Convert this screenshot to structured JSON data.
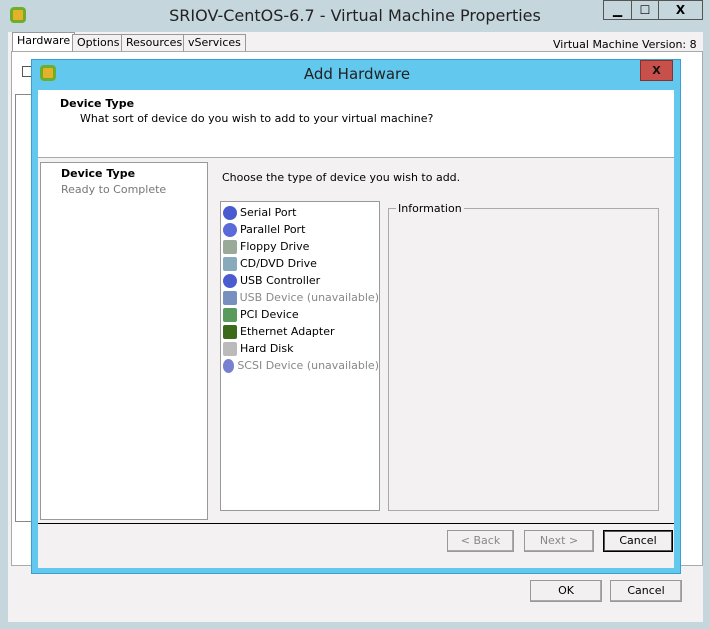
{
  "window": {
    "title": "SRIOV-CentOS-6.7 - Virtual Machine Properties",
    "minimize": "▁",
    "maximize": "☐",
    "close": "X",
    "tabs": [
      {
        "label": "Hardware"
      },
      {
        "label": "Options"
      },
      {
        "label": "Resources"
      },
      {
        "label": "vServices"
      }
    ],
    "version": "Virtual Machine Version: 8",
    "ok": "OK",
    "cancel": "Cancel"
  },
  "dialog": {
    "title": "Add Hardware",
    "close": "X",
    "header": {
      "title": "Device Type",
      "subtitle": "What sort of device do you wish to add to your virtual machine?"
    },
    "steps": [
      {
        "label": "Device Type",
        "active": true
      },
      {
        "label": "Ready to Complete",
        "active": false
      }
    ],
    "prompt": "Choose the type of device you wish to add.",
    "devices": [
      {
        "label": "Serial Port",
        "icon": "serial-port-icon",
        "available": true
      },
      {
        "label": "Parallel Port",
        "icon": "parallel-port-icon",
        "available": true
      },
      {
        "label": "Floppy Drive",
        "icon": "floppy-drive-icon",
        "available": true
      },
      {
        "label": "CD/DVD Drive",
        "icon": "cd-dvd-drive-icon",
        "available": true
      },
      {
        "label": "USB Controller",
        "icon": "usb-controller-icon",
        "available": true
      },
      {
        "label": "USB Device (unavailable)",
        "icon": "usb-device-icon",
        "available": false
      },
      {
        "label": "PCI Device",
        "icon": "pci-device-icon",
        "available": true
      },
      {
        "label": "Ethernet Adapter",
        "icon": "ethernet-adapter-icon",
        "available": true
      },
      {
        "label": "Hard Disk",
        "icon": "hard-disk-icon",
        "available": true
      },
      {
        "label": "SCSI Device (unavailable)",
        "icon": "scsi-device-icon",
        "available": false
      }
    ],
    "info_label": "Information",
    "back": "< Back",
    "next": "Next >",
    "cancel": "Cancel"
  },
  "colors": {
    "dialog_frame": "#62c8ee",
    "close_button": "#c7504a",
    "window_frame": "#c5d7dd"
  }
}
